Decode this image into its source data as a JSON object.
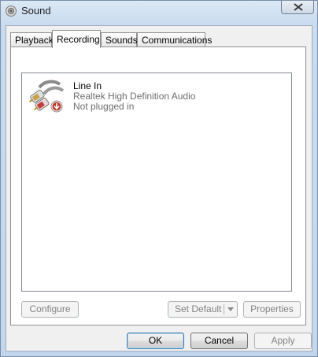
{
  "window": {
    "title": "Sound",
    "close_label": "✕"
  },
  "tabs": [
    {
      "label": "Playback",
      "active": false
    },
    {
      "label": "Recording",
      "active": true
    },
    {
      "label": "Sounds",
      "active": false
    },
    {
      "label": "Communications",
      "active": false
    }
  ],
  "devices": [
    {
      "name": "Line In",
      "driver": "Realtek High Definition Audio",
      "status": "Not plugged in",
      "icon": "line-in-cable-icon"
    }
  ],
  "panel_buttons": {
    "configure": "Configure",
    "set_default": "Set Default",
    "properties": "Properties"
  },
  "dialog_buttons": {
    "ok": "OK",
    "cancel": "Cancel",
    "apply": "Apply"
  },
  "colors": {
    "status_badge": "#c0392b",
    "cable_red": "#c43b3b",
    "secondary_text": "#6d6d6d"
  }
}
